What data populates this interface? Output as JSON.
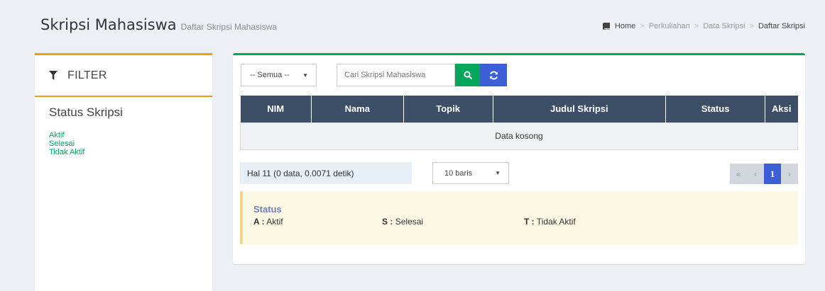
{
  "header": {
    "title": "Skripsi Mahasiswa",
    "subtitle": "Daftar Skripsi Mahasiswa"
  },
  "breadcrumb": {
    "home": "Home",
    "items": [
      "Perkuliahan",
      "Data Skripsi",
      "Daftar Skripsi"
    ],
    "separator": ">"
  },
  "filter": {
    "title": "FILTER",
    "section_title": "Status Skripsi",
    "options": [
      "Aktif",
      "Selesai",
      "Tidak Aktif"
    ]
  },
  "toolbar": {
    "status_select_value": "-- Semua --",
    "search_placeholder": "Cari Skripsi Mahasiswa"
  },
  "table": {
    "columns": [
      "NIM",
      "Nama",
      "Topik",
      "Judul Skripsi",
      "Status",
      "Aksi"
    ],
    "empty_text": "Data kosong"
  },
  "pagination": {
    "info": "Hal 11 (0 data, 0.0071 detik)",
    "rows_select_value": "10 baris",
    "first": "«",
    "prev": "‹",
    "current": "1",
    "next": "›"
  },
  "legend": {
    "title": "Status",
    "items": [
      {
        "code": "A :",
        "label": "Aktif"
      },
      {
        "code": "S :",
        "label": "Selesai"
      },
      {
        "code": "T :",
        "label": "Tidak Aktif"
      }
    ]
  },
  "colors": {
    "accent_green": "#00a65a",
    "accent_orange": "#f39c12",
    "accent_blue": "#3c5fd6",
    "table_header": "#3c4f67"
  },
  "icons": {
    "breadcrumb": "book-icon",
    "filter": "funnel-icon",
    "search": "search-icon",
    "reset": "refresh-icon"
  }
}
